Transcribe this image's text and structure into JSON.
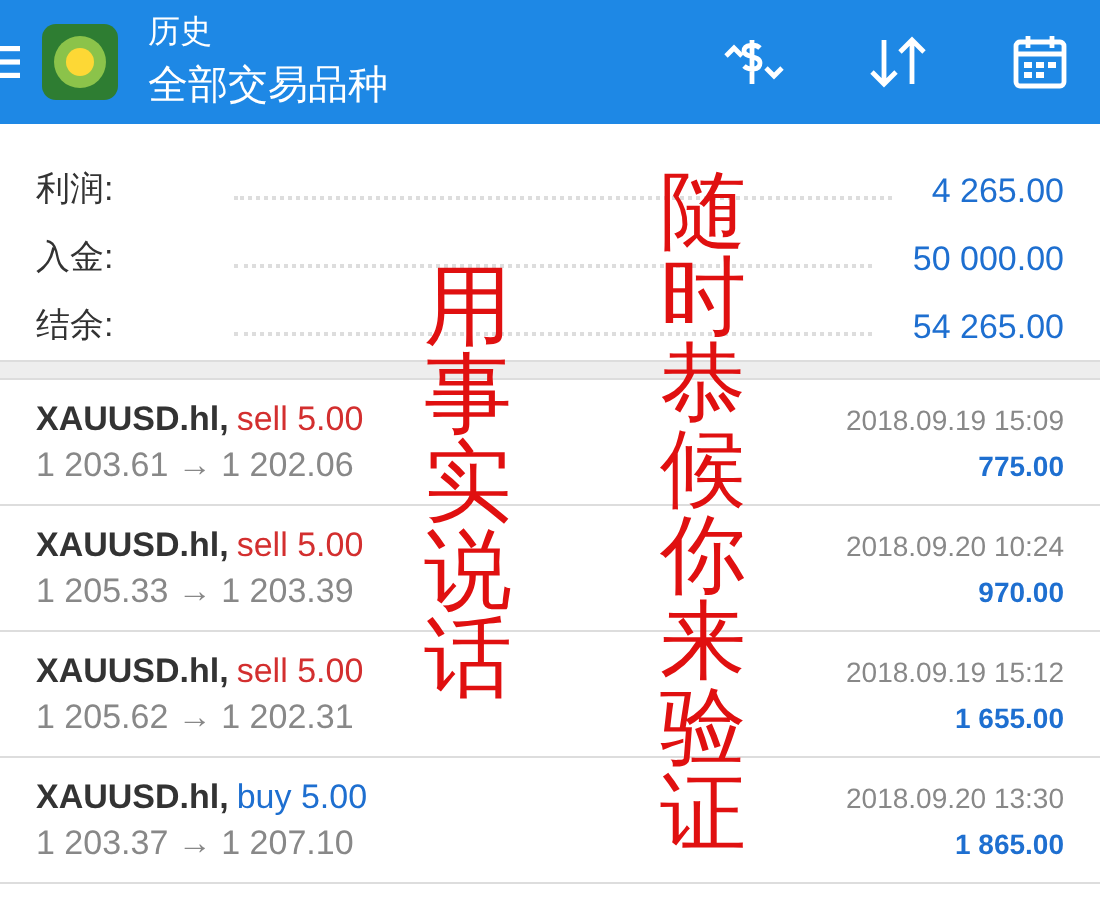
{
  "header": {
    "title": "历史",
    "subtitle": "全部交易品种"
  },
  "summary": [
    {
      "label": "利润:",
      "value": "4 265.00"
    },
    {
      "label": "入金:",
      "value": "50 000.00"
    },
    {
      "label": "结余:",
      "value": "54 265.00"
    }
  ],
  "deals": [
    {
      "symbol": "XAUUSD.hl,",
      "kind": "sell",
      "side": "sell 5.00",
      "prices": "1 203.61 → 1 202.06",
      "time": "2018.09.19 15:09",
      "profit": "775.00"
    },
    {
      "symbol": "XAUUSD.hl,",
      "kind": "sell",
      "side": "sell 5.00",
      "prices": "1 205.33 → 1 203.39",
      "time": "2018.09.20 10:24",
      "profit": "970.00"
    },
    {
      "symbol": "XAUUSD.hl,",
      "kind": "sell",
      "side": "sell 5.00",
      "prices": "1 205.62 → 1 202.31",
      "time": "2018.09.19 15:12",
      "profit": "1 655.00"
    },
    {
      "symbol": "XAUUSD.hl,",
      "kind": "buy",
      "side": "buy 5.00",
      "prices": "1 203.37 → 1 207.10",
      "time": "2018.09.20 13:30",
      "profit": "1 865.00"
    }
  ],
  "overlay_texts": [
    "用事实说话",
    "随时恭候你来验证"
  ]
}
